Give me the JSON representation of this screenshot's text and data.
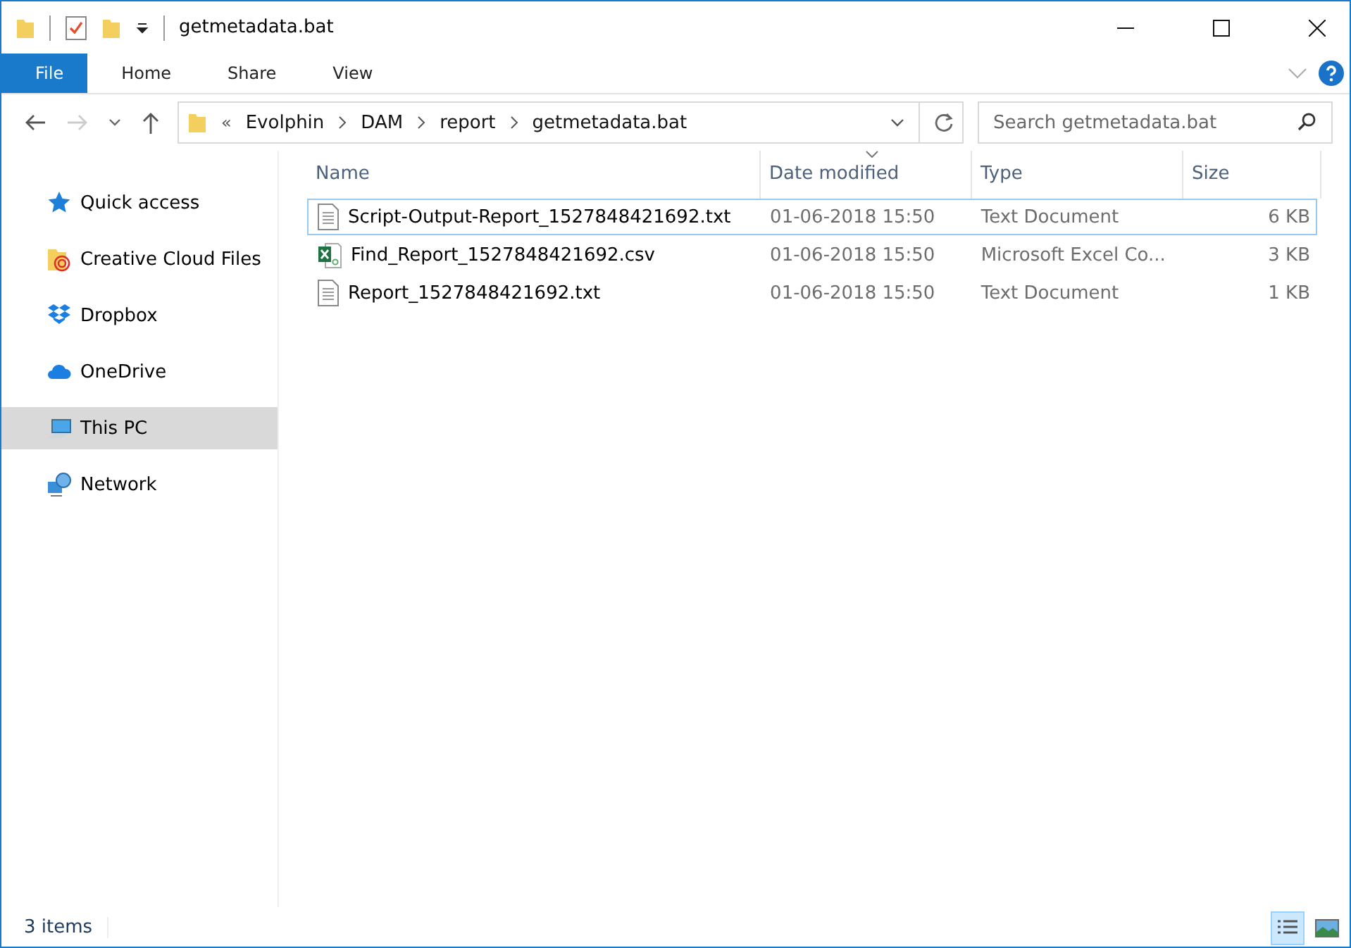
{
  "window": {
    "title": "getmetadata.bat"
  },
  "ribbon_tabs": [
    {
      "label": "File",
      "selected": true
    },
    {
      "label": "Home",
      "selected": false
    },
    {
      "label": "Share",
      "selected": false
    },
    {
      "label": "View",
      "selected": false
    }
  ],
  "address": {
    "overflow": "«",
    "segments": [
      "Evolphin",
      "DAM",
      "report",
      "getmetadata.bat"
    ]
  },
  "search": {
    "placeholder": "Search getmetadata.bat"
  },
  "sidebar": {
    "items": [
      {
        "label": "Quick access",
        "kind": "star",
        "selected": false
      },
      {
        "label": "Creative Cloud Files",
        "kind": "cloudfiles",
        "selected": false
      },
      {
        "label": "Dropbox",
        "kind": "dropbox",
        "selected": false
      },
      {
        "label": "OneDrive",
        "kind": "onedrive",
        "selected": false
      },
      {
        "label": "This PC",
        "kind": "pc",
        "selected": true
      },
      {
        "label": "Network",
        "kind": "network",
        "selected": false
      }
    ]
  },
  "table": {
    "columns": [
      "Name",
      "Date modified",
      "Type",
      "Size"
    ],
    "rows": [
      {
        "kind": "text",
        "name": "Script-Output-Report_1527848421692.txt",
        "date": "01-06-2018 15:50",
        "type": "Text Document",
        "size": "6 KB",
        "focused": true
      },
      {
        "kind": "excel",
        "name": "Find_Report_1527848421692.csv",
        "date": "01-06-2018 15:50",
        "type": "Microsoft Excel Co...",
        "size": "3 KB",
        "focused": false
      },
      {
        "kind": "text",
        "name": "Report_1527848421692.txt",
        "date": "01-06-2018 15:50",
        "type": "Text Document",
        "size": "1 KB",
        "focused": false
      }
    ]
  },
  "status_bar": {
    "count": "3 items",
    "views": [
      {
        "kind": "details",
        "selected": true
      },
      {
        "kind": "thumbs",
        "selected": false
      }
    ]
  }
}
